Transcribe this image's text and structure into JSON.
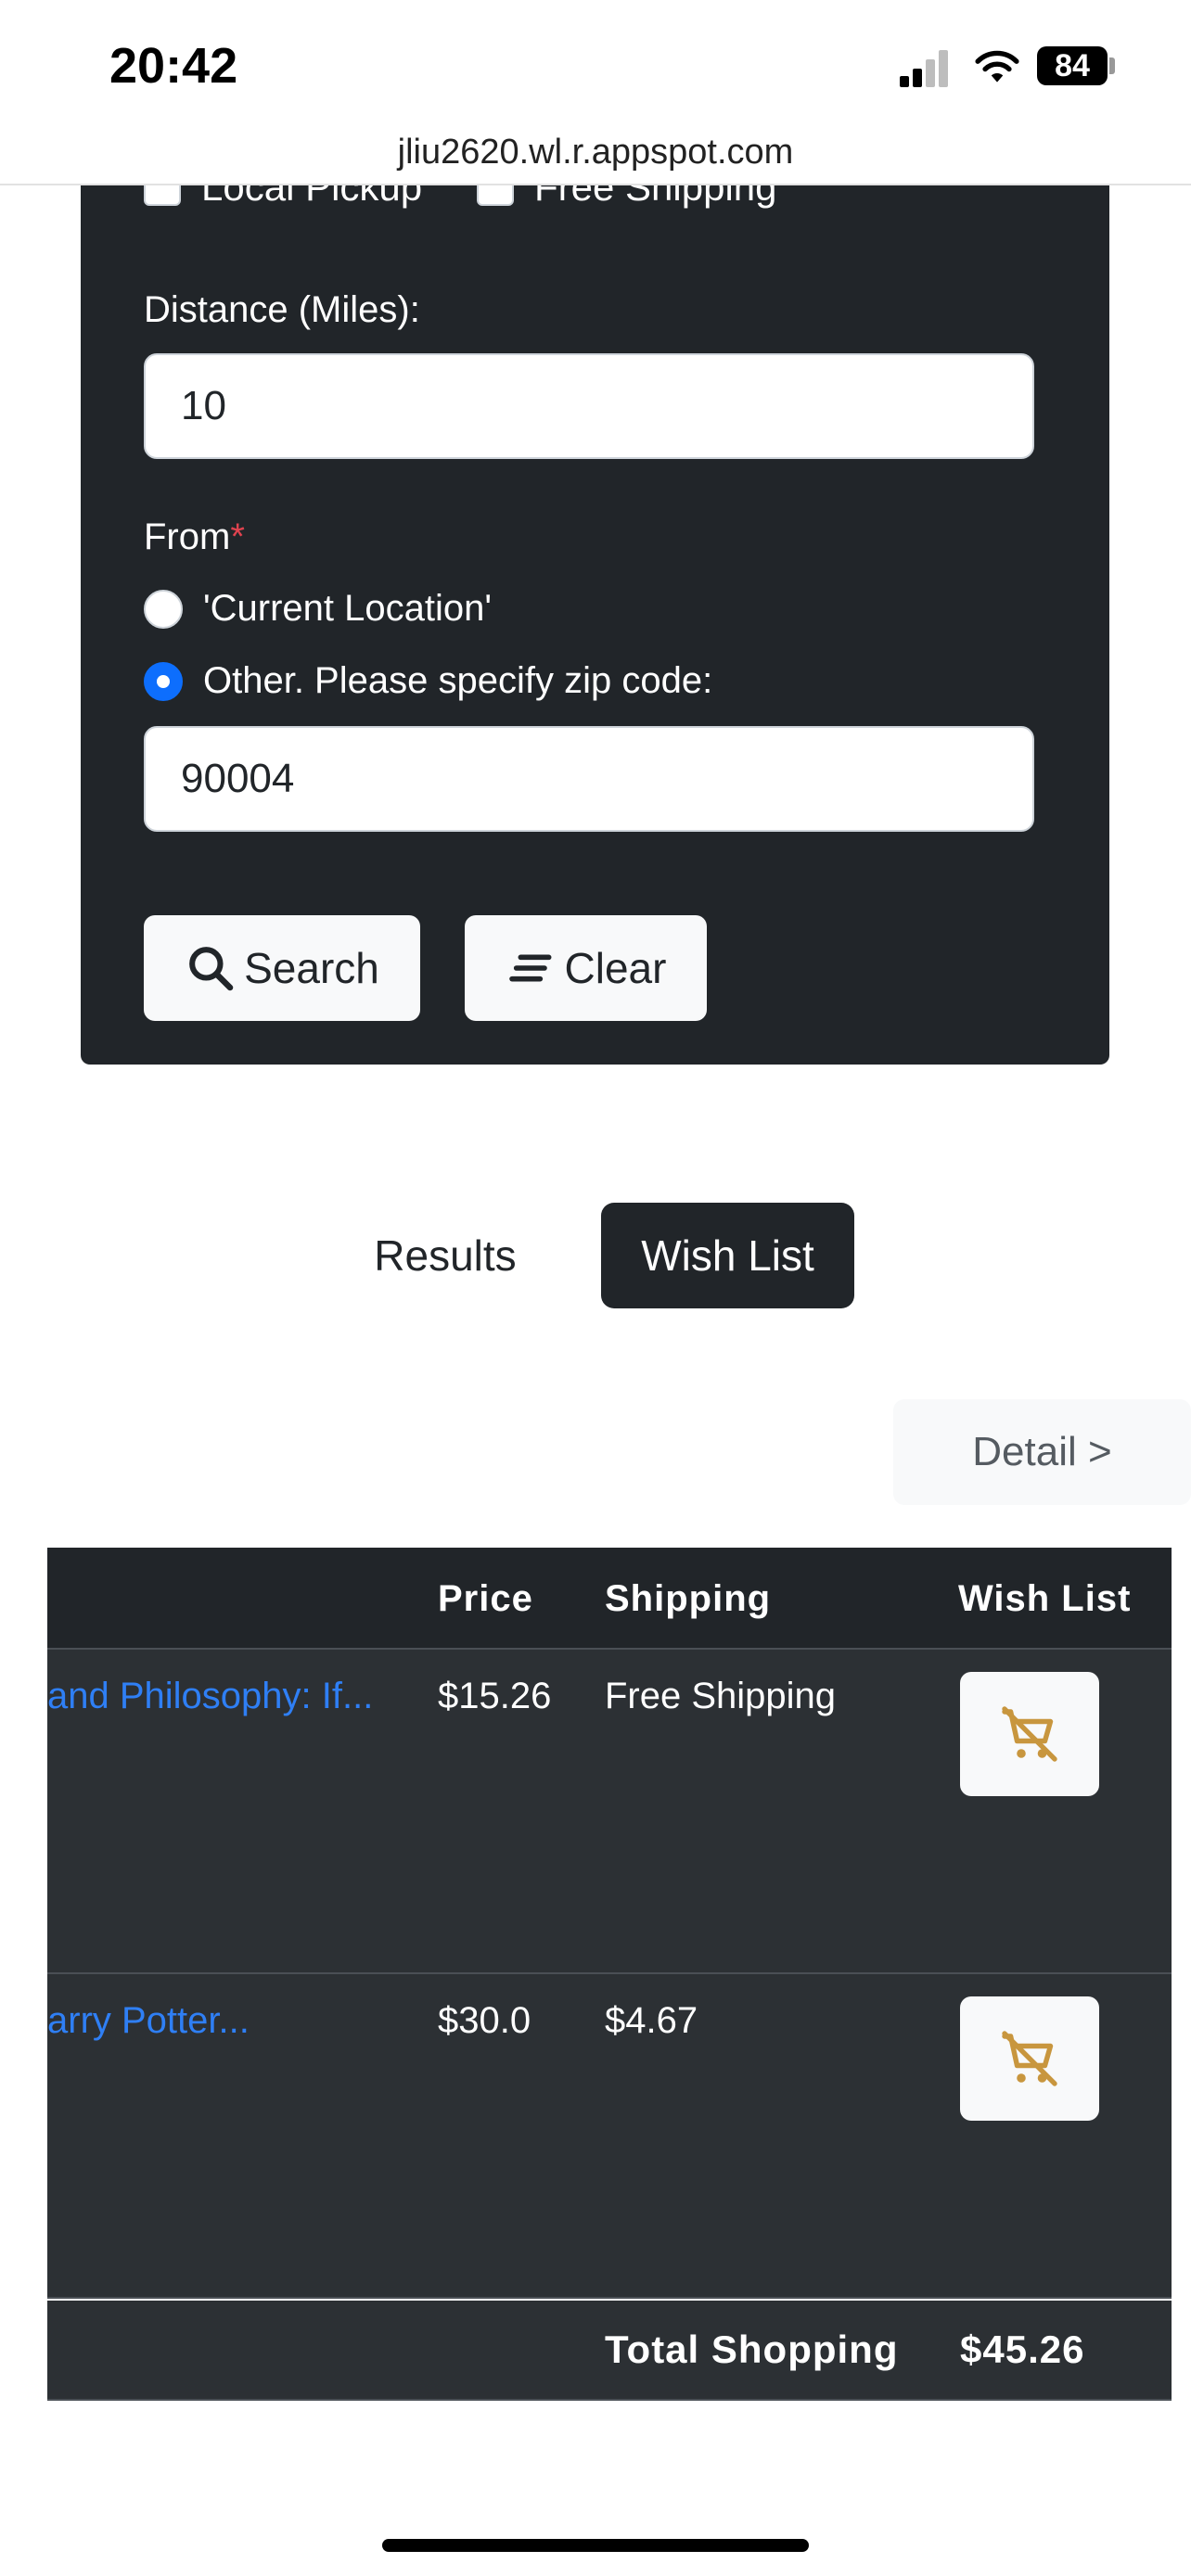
{
  "status_bar": {
    "time": "20:42",
    "battery": "84"
  },
  "browser": {
    "url": "jliu2620.wl.r.appspot.com"
  },
  "form": {
    "checkbox_local_pickup": "Local Pickup",
    "checkbox_free_shipping": "Free Shipping",
    "distance_label": "Distance (Miles):",
    "distance_value": "10",
    "from_label": "From",
    "required_mark": "*",
    "radio_current_location": "'Current Location'",
    "radio_other": "Other. Please specify zip code:",
    "zip_value": "90004",
    "search_button": "Search",
    "clear_button": "Clear"
  },
  "tabs": {
    "results": "Results",
    "wish_list": "Wish List",
    "active": "wish_list"
  },
  "detail_button": "Detail >",
  "table": {
    "headers": {
      "price": "Price",
      "shipping": "Shipping",
      "wish_list": "Wish List"
    },
    "rows": [
      {
        "title": "and Philosophy: If...",
        "price": "$15.26",
        "shipping": "Free Shipping",
        "wish_icon": "remove-from-cart-icon"
      },
      {
        "title": "arry Potter...",
        "price": "$30.0",
        "shipping": "$4.67",
        "wish_icon": "remove-from-cart-icon"
      }
    ],
    "footer": {
      "label": "Total Shopping",
      "total": "$45.26"
    }
  },
  "colors": {
    "panel_dark": "#212529",
    "row_dark": "#2c3034",
    "link_blue": "#2f7ff5",
    "radio_blue": "#0d6efd",
    "cart_icon_gold": "#c8963e",
    "required_red": "#e0434f"
  }
}
